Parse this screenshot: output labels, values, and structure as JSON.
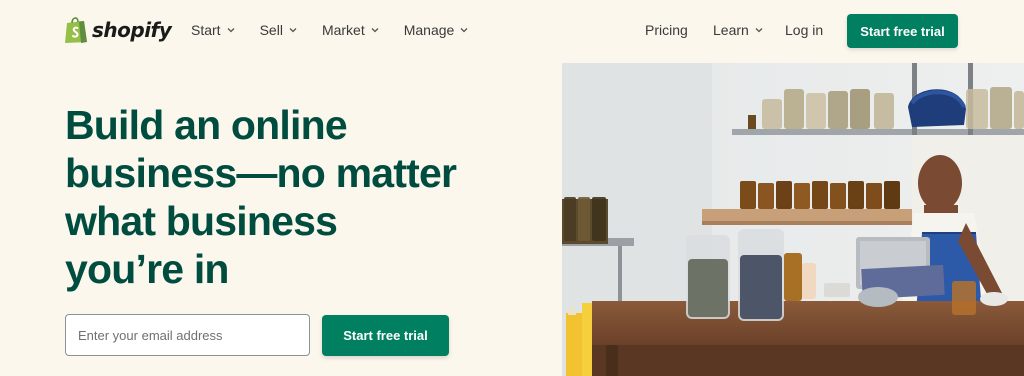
{
  "brand": {
    "name": "shopify",
    "logo_icon": "shopping-bag-logo",
    "accent": "#008060",
    "heading_color": "#004c3f",
    "background": "#fbf7ed"
  },
  "nav": {
    "left": [
      {
        "label": "Start",
        "has_dropdown": true
      },
      {
        "label": "Sell",
        "has_dropdown": true
      },
      {
        "label": "Market",
        "has_dropdown": true
      },
      {
        "label": "Manage",
        "has_dropdown": true
      }
    ],
    "right": [
      {
        "label": "Pricing",
        "has_dropdown": false
      },
      {
        "label": "Learn",
        "has_dropdown": true
      },
      {
        "label": "Log in",
        "has_dropdown": false
      }
    ],
    "cta_label": "Start free trial"
  },
  "hero": {
    "title_lines": [
      "Build an online",
      "business—no matter",
      "what business",
      "you’re in"
    ],
    "email_placeholder": "Enter your email address",
    "cta_label": "Start free trial",
    "image": "woman-working-on-tablet-in-shop-with-jars"
  }
}
